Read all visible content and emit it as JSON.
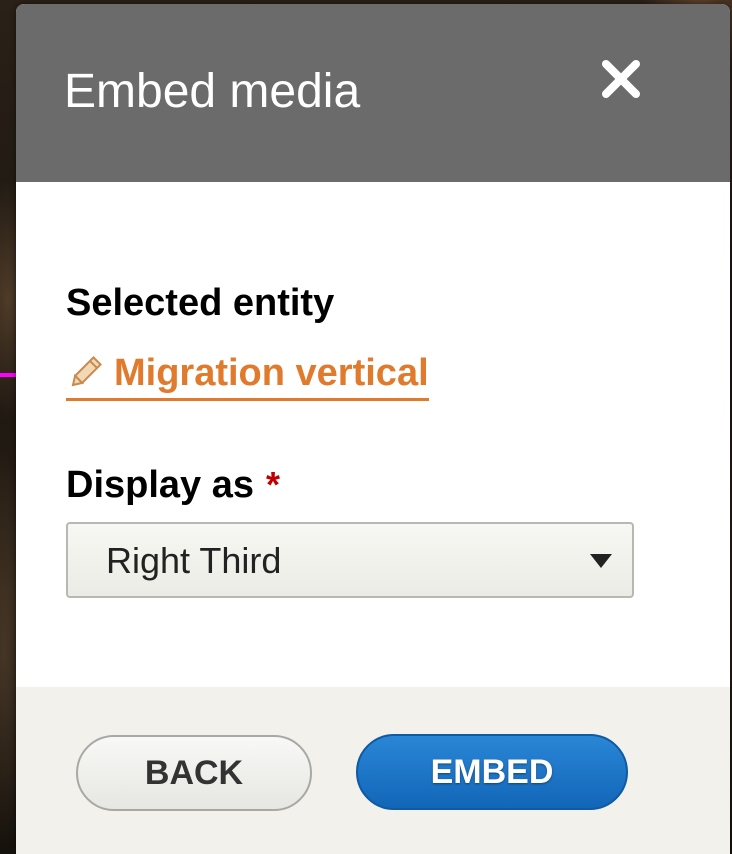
{
  "dialog": {
    "title": "Embed media",
    "close_icon": "close-icon",
    "close_glyph": "✕"
  },
  "form": {
    "selected_entity_label": "Selected entity",
    "entity_link_text": "Migration vertical",
    "entity_link_icon": "pencil-icon",
    "display_as_label": "Display as",
    "required_marker": "*",
    "display_as_selected": "Right Third"
  },
  "footer": {
    "back_label": "BACK",
    "embed_label": "EMBED"
  },
  "colors": {
    "titlebar": "#6b6b6b",
    "link": "#e07a2c",
    "required": "#c00000",
    "primary_button": "#1a6fc4",
    "pointer_arrow": "#ff00ff"
  }
}
